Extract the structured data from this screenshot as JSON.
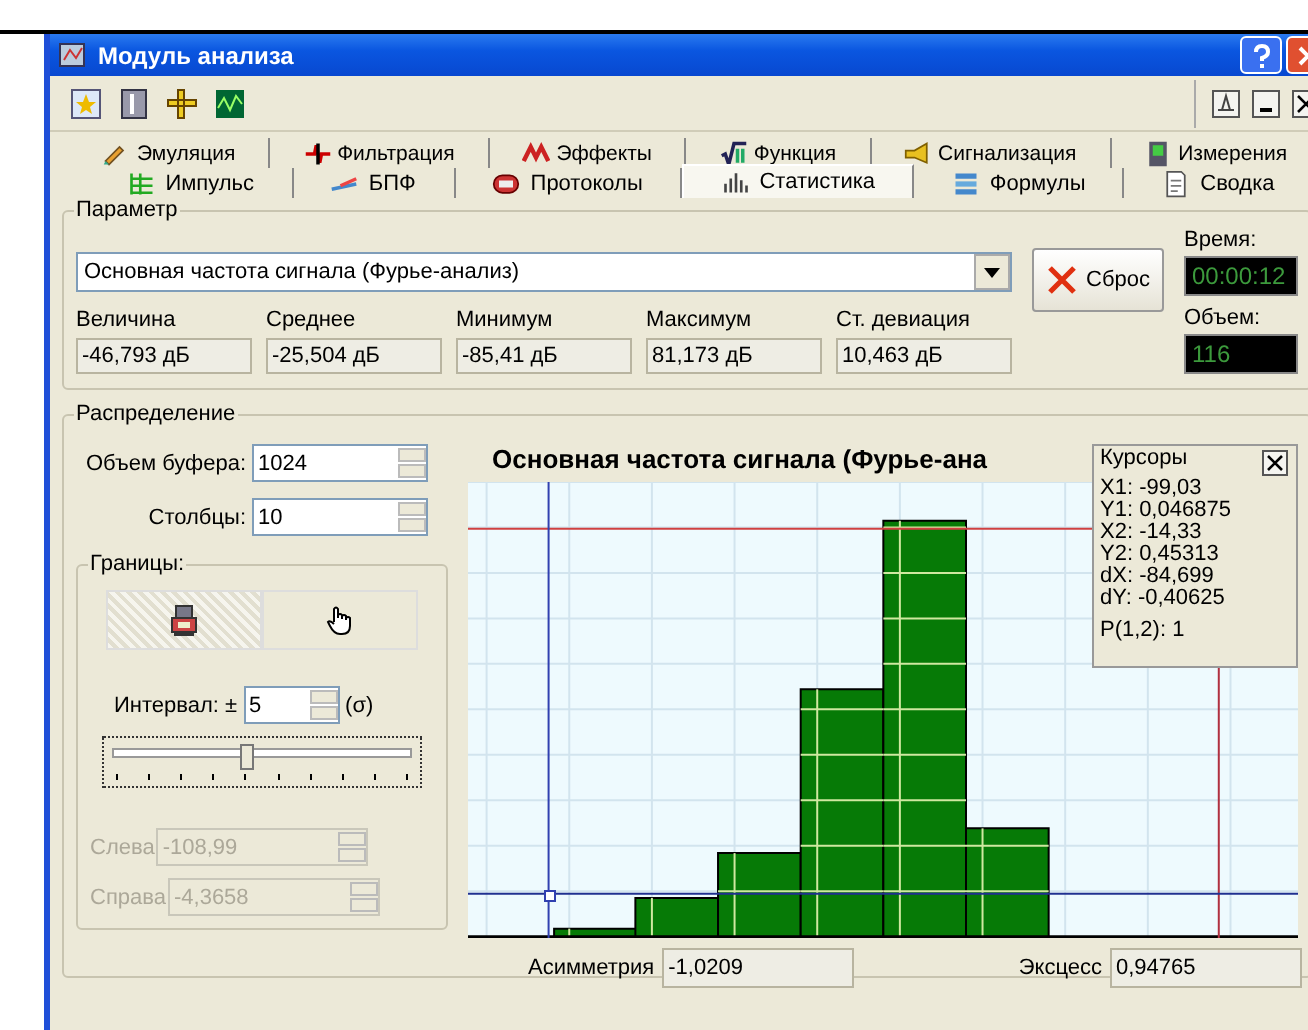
{
  "window": {
    "title": "Модуль анализа"
  },
  "tabs_back": [
    {
      "label": "Эмуляция",
      "selected": false
    },
    {
      "label": "Фильтрация",
      "selected": false
    },
    {
      "label": "Эффекты",
      "selected": false
    },
    {
      "label": "Функция",
      "selected": false
    },
    {
      "label": "Сигнализация",
      "selected": false
    },
    {
      "label": "Измерения",
      "selected": false
    }
  ],
  "tabs_front": [
    {
      "label": "Импульс",
      "selected": false
    },
    {
      "label": "БПФ",
      "selected": false
    },
    {
      "label": "Протоколы",
      "selected": false
    },
    {
      "label": "Статистика",
      "selected": true
    },
    {
      "label": "Формулы",
      "selected": false
    },
    {
      "label": "Сводка",
      "selected": false
    }
  ],
  "parameter": {
    "legend": "Параметр",
    "value": "Основная частота сигнала (Фурье-анализ)",
    "reset_button": "Сброс",
    "time_label": "Время:",
    "time": "00:00:12",
    "volume_label": "Объем:",
    "volume": "116"
  },
  "stats": [
    {
      "label": "Величина",
      "value": "-46,793 дБ"
    },
    {
      "label": "Среднее",
      "value": "-25,504 дБ"
    },
    {
      "label": "Минимум",
      "value": "-85,41 дБ"
    },
    {
      "label": "Максимум",
      "value": "81,173 дБ"
    },
    {
      "label": "Ст. девиация",
      "value": "10,463 дБ"
    }
  ],
  "distribution": {
    "legend": "Распределение",
    "buffer_label": "Объем буфера:",
    "buffer": "1024",
    "columns_label": "Столбцы:",
    "columns": "10",
    "bounds_legend": "Границы:",
    "mode_buttons": [
      {
        "kind": "device",
        "selected": true
      },
      {
        "kind": "hand",
        "selected": false
      }
    ],
    "interval_label": "Интервал: ±",
    "interval": "5",
    "sigma": "(σ)",
    "slider": {
      "level": 0.45
    },
    "bounds": [
      {
        "label": "Слева",
        "value": "-108,99",
        "disabled": true
      },
      {
        "label": "Справа",
        "value": "-4,3658",
        "disabled": true
      }
    ]
  },
  "chart": {
    "title": "Основная частота сигнала (Фурье-ана",
    "cursors_legend": "Курсоры",
    "cursors": [
      "X1: -99,03",
      "Y1: 0,046875",
      "X2: -14,33",
      "Y2: 0,45313",
      "dX: -84,699",
      "dY: -0,40625",
      "P(1,2): 1"
    ],
    "asymmetry_label": "Асимметрия",
    "asymmetry": "-1,0209",
    "excess_label": "Эксцесс",
    "excess": "0,94765"
  }
}
